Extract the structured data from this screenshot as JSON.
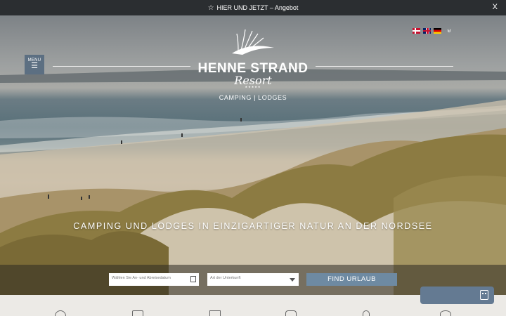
{
  "announcement": {
    "icon": "star-icon",
    "text": "HIER UND JETZT – Angebot",
    "close_label": "X"
  },
  "header": {
    "languages": [
      {
        "code": "da",
        "icon": "flag-denmark-icon"
      },
      {
        "code": "en",
        "icon": "flag-uk-icon"
      },
      {
        "code": "de",
        "icon": "flag-germany-icon"
      }
    ],
    "basket_icon": "basket-icon",
    "menu_label": "MENU",
    "menu_icon": "hamburger-icon"
  },
  "logo": {
    "name": "HENNE STRAND",
    "script": "Resort",
    "stars": "★★★★★",
    "subtitle": "CAMPING | LODGES"
  },
  "hero": {
    "tagline": "CAMPING UND LODGES IN EINZIGARTIGER NATUR AN DER NORDSEE"
  },
  "search": {
    "date_placeholder": "Wählen Sie An- und Abreisedatum",
    "type_placeholder": "Art der Unterkunft",
    "find_label": "FIND URLAUB"
  },
  "chat": {
    "icon": "robot-icon"
  },
  "colors": {
    "accent": "#6e8aa2",
    "menu": "#5c6f82",
    "topbar": "#2b2e31"
  }
}
